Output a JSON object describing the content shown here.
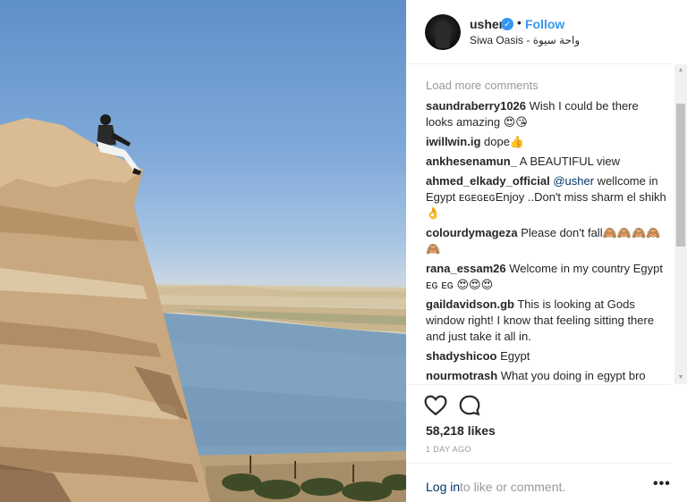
{
  "post": {
    "username": "usher",
    "verified_mark": "✓",
    "separator": "•",
    "follow_label": "Follow",
    "location": "Siwa Oasis - واحة سيوة"
  },
  "comments": {
    "load_more": "Load more comments",
    "items": [
      {
        "user": "saundraberry1026",
        "text": " Wish I could be there looks amazing 😍😘"
      },
      {
        "user": "iwillwin.ig",
        "text": " dope👍"
      },
      {
        "user": "ankhesenamun_",
        "text": " A BEAUTIFUL view"
      },
      {
        "user": "ahmed_elkady_official",
        "mention": " @usher",
        "text": " wellcome in Egypt ᴇɢᴇɢᴇɢEnjoy ..Don't miss sharm el shikh 👌"
      },
      {
        "user": "colourdymageza",
        "text": " Please don't fall🙈🙈🙈🙈🙈"
      },
      {
        "user": "rana_essam26",
        "text": " Welcome in my country Egypt ᴇɢ ᴇɢ 😍😍😍"
      },
      {
        "user": "gaildavidson.gb",
        "text": " This is looking at Gods window right! I know that feeling sitting there and just take it all in."
      },
      {
        "user": "shadyshicoo",
        "text": " Egypt"
      },
      {
        "user": "nourmotrash",
        "text": " What you doing in egypt bro"
      }
    ]
  },
  "actions": {
    "like_icon": "heart-outline",
    "comment_icon": "speech-bubble-outline",
    "likes": "58,218 likes",
    "time_ago": "1 DAY AGO"
  },
  "footer": {
    "login_label": "Log in",
    "login_rest": " to like or comment.",
    "more_label": "•••"
  },
  "scrollbar": {
    "up_arrow": "▲",
    "down_arrow": "▼"
  },
  "colors": {
    "accent": "#3897f0",
    "link": "#003569",
    "muted": "#999999",
    "text": "#262626"
  }
}
